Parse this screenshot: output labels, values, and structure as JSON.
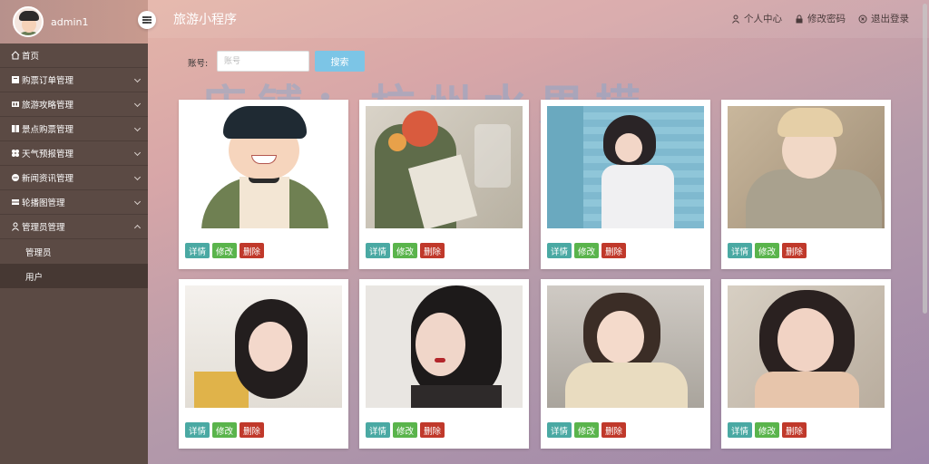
{
  "sidebar": {
    "username": "admin1",
    "menu": [
      {
        "label": "首页",
        "icon": "home-icon",
        "expandable": false
      },
      {
        "label": "购票订单管理",
        "icon": "receipt-icon",
        "expandable": true
      },
      {
        "label": "旅游攻略管理",
        "icon": "guide-icon",
        "expandable": true
      },
      {
        "label": "景点购票管理",
        "icon": "ticket-icon",
        "expandable": true
      },
      {
        "label": "天气预报管理",
        "icon": "weather-icon",
        "expandable": true
      },
      {
        "label": "新闻资讯管理",
        "icon": "news-icon",
        "expandable": true
      },
      {
        "label": "轮播图管理",
        "icon": "carousel-icon",
        "expandable": true
      },
      {
        "label": "管理员管理",
        "icon": "user-icon",
        "expandable": true,
        "expanded": true
      }
    ],
    "submenu": [
      {
        "label": "管理员",
        "active": false
      },
      {
        "label": "用户",
        "active": true
      }
    ]
  },
  "header": {
    "title": "旅游小程序",
    "links": [
      {
        "label": "个人中心",
        "icon": "person-icon"
      },
      {
        "label": "修改密码",
        "icon": "lock-icon"
      },
      {
        "label": "退出登录",
        "icon": "logout-icon"
      }
    ]
  },
  "search": {
    "label": "账号:",
    "placeholder": "账号",
    "value": "",
    "button": "搜索"
  },
  "watermark": "店铺：杭州水果捞",
  "card_buttons": {
    "detail": "详情",
    "edit": "修改",
    "delete": "删除"
  },
  "cards": [
    {
      "image": "cartoon-man-avatar"
    },
    {
      "image": "woman-with-bouquet"
    },
    {
      "image": "girl-by-pool"
    },
    {
      "image": "young-man-portrait"
    },
    {
      "image": "woman-portrait-yellow"
    },
    {
      "image": "woman-portrait-dark"
    },
    {
      "image": "girl-with-earrings"
    },
    {
      "image": "woman-smiling-portrait"
    }
  ],
  "colors": {
    "sidebar": "#5b4a44",
    "detail_button": "#4aa9a3",
    "edit_button": "#5ab44c",
    "delete_button": "#c0392b",
    "search_button": "#7cc5e6"
  }
}
